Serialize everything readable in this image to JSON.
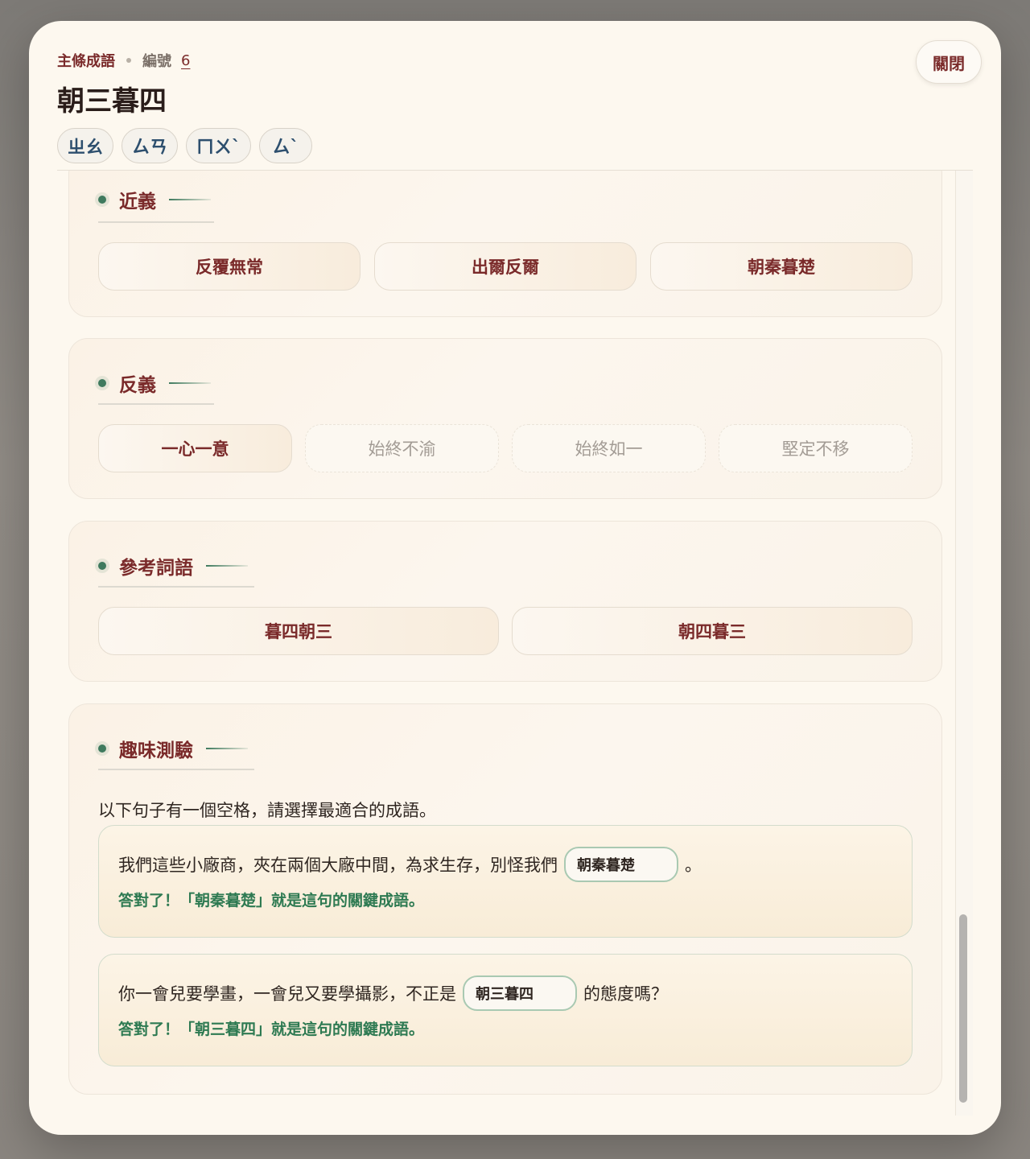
{
  "header": {
    "category": "主條成語",
    "number_label": "編號",
    "number": "6",
    "title": "朝三暮四",
    "zhuyin": [
      "ㄓㄠ",
      "ㄙㄢ",
      "ㄇㄨˋ",
      "ㄙˋ"
    ],
    "close_label": "關閉"
  },
  "synonyms": {
    "label": "近義",
    "items": [
      "反覆無常",
      "出爾反爾",
      "朝秦暮楚"
    ]
  },
  "antonyms": {
    "label": "反義",
    "items": [
      "一心一意",
      "始終不渝",
      "始終如一",
      "堅定不移"
    ]
  },
  "references": {
    "label": "參考詞語",
    "items": [
      "暮四朝三",
      "朝四暮三"
    ]
  },
  "quiz": {
    "label": "趣味測驗",
    "intro": "以下句子有一個空格，請選擇最適合的成語。",
    "questions": [
      {
        "before": "我們這些小廠商，夾在兩個大廠中間，為求生存，別怪我們",
        "answer": "朝秦暮楚",
        "after": "。",
        "feedback": "答對了！「朝秦暮楚」就是這句的關鍵成語。"
      },
      {
        "before": "你一會兒要學畫，一會兒又要學攝影，不正是",
        "answer": "朝三暮四",
        "after": "的態度嗎？",
        "feedback": "答對了！「朝三暮四」就是這句的關鍵成語。"
      }
    ]
  }
}
